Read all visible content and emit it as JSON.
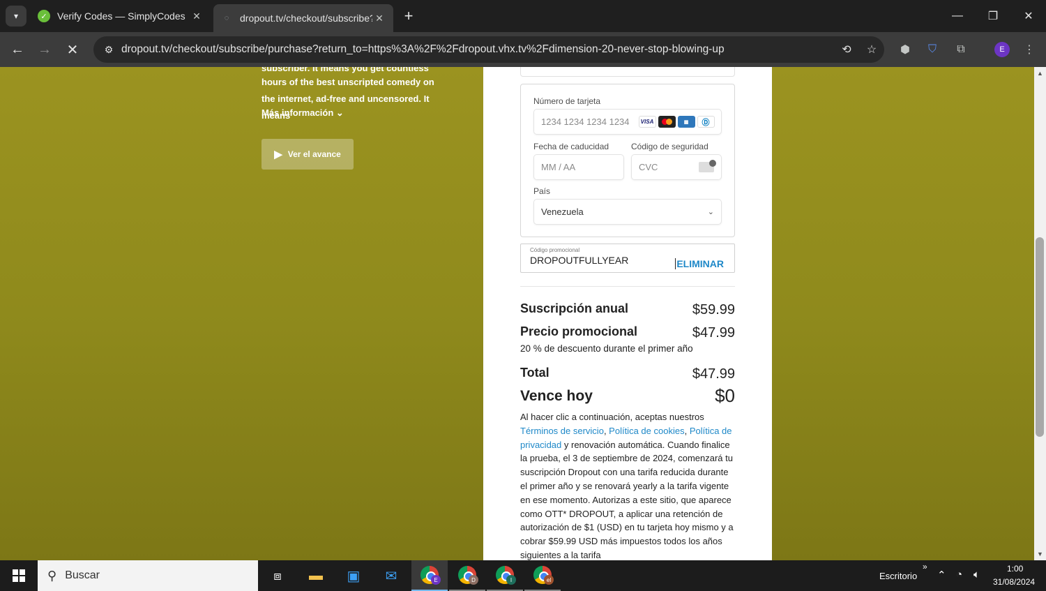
{
  "browser": {
    "tabs": [
      {
        "title": "Verify Codes — SimplyCodes",
        "active": false
      },
      {
        "title": "dropout.tv/checkout/subscribe?",
        "active": true
      }
    ],
    "new_tab": "+",
    "url": "dropout.tv/checkout/subscribe/purchase?return_to=https%3A%2F%2Fdropout.vhx.tv%2Fdimension-20-never-stop-blowing-up",
    "profile_initial": "E"
  },
  "page": {
    "left": {
      "cut_line": "subscriber. It means you get countless",
      "description": "hours of the best unscripted comedy on the internet, ad-free and uncensored. It means",
      "more_info": "Más información ⌄",
      "trailer_button": "Ver el avance"
    },
    "card_form": {
      "card_number_label": "Número de tarjeta",
      "card_number_placeholder": "1234 1234 1234 1234",
      "brands": [
        "VISA",
        "Mastercard",
        "AMEX",
        "Diners"
      ],
      "expiry_label": "Fecha de caducidad",
      "expiry_placeholder": "MM / AA",
      "cvc_label": "Código de seguridad",
      "cvc_placeholder": "CVC",
      "country_label": "País",
      "country_value": "Venezuela"
    },
    "promo": {
      "label": "Código promocional",
      "code": "DROPOUTFULLYEAR",
      "remove": "ELIMINAR"
    },
    "summary": {
      "annual_label": "Suscripción anual",
      "annual_amount": "$59.99",
      "promo_label": "Precio promocional",
      "promo_amount": "$47.99",
      "promo_note": "20 % de descuento durante el primer año",
      "total_label": "Total",
      "total_amount": "$47.99",
      "due_label": "Vence hoy",
      "due_amount": "$0"
    },
    "terms": {
      "intro": "Al hacer clic a continuación, aceptas nuestros ",
      "terms_link": "Términos de servicio",
      "sep1": ", ",
      "cookies_link": "Política de cookies",
      "sep2": ", ",
      "privacy_link": "Política de privacidad",
      "body": " y renovación automática. Cuando finalice la prueba, el 3 de septiembre de 2024, comenzará tu suscripción Dropout con una tarifa reducida durante el primer año y se renovará yearly a la tarifa vigente en ese momento. Autorizas a este sitio, que aparece como OTT* DROPOUT, a aplicar una retención de autorización de $1 (USD) en tu tarjeta hoy mismo y a cobrar $59.99 USD más impuestos todos los años siguientes a la tarifa"
    }
  },
  "taskbar": {
    "search_placeholder": "Buscar",
    "chrome_badges": [
      "E",
      "D",
      "I",
      "el"
    ],
    "desktop_label": "Escritorio",
    "time": "1:00",
    "date": "31/08/2024"
  },
  "colors": {
    "page_bg": "#938d1e",
    "link": "#1e88c8",
    "profile": "#6c35c4"
  }
}
